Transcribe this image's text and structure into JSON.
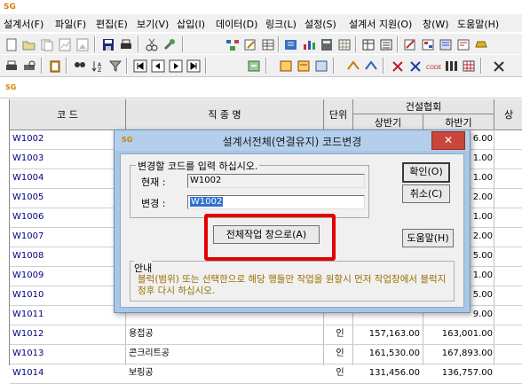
{
  "app_logo": "SG",
  "menu": [
    "설계서(F)",
    "파일(F)",
    "편집(E)",
    "보기(V)",
    "삽입(I)",
    "데이터(D)",
    "링크(L)",
    "설정(S)",
    "설계서 지원(O)",
    "창(W)",
    "도움말(H)"
  ],
  "grid": {
    "headers": {
      "code": "코 드",
      "name": "직 종 명",
      "unit": "단위",
      "group": "건설협회",
      "first_half": "상반기",
      "second_half": "하반기",
      "extra": "상"
    },
    "rows": [
      {
        "code": "W1002",
        "name": "",
        "unit": "",
        "first_half": "",
        "second_half": "6.00"
      },
      {
        "code": "W1003",
        "name": "",
        "unit": "",
        "first_half": "",
        "second_half": "1.00"
      },
      {
        "code": "W1004",
        "name": "",
        "unit": "",
        "first_half": "",
        "second_half": "1.00"
      },
      {
        "code": "W1005",
        "name": "",
        "unit": "",
        "first_half": "",
        "second_half": "2.00"
      },
      {
        "code": "W1006",
        "name": "",
        "unit": "",
        "first_half": "",
        "second_half": "1.00"
      },
      {
        "code": "W1007",
        "name": "",
        "unit": "",
        "first_half": "",
        "second_half": "2.00"
      },
      {
        "code": "W1008",
        "name": "",
        "unit": "",
        "first_half": "",
        "second_half": "5.00"
      },
      {
        "code": "W1009",
        "name": "",
        "unit": "",
        "first_half": "",
        "second_half": "1.00"
      },
      {
        "code": "W1010",
        "name": "",
        "unit": "",
        "first_half": "",
        "second_half": "5.00"
      },
      {
        "code": "W1011",
        "name": "",
        "unit": "",
        "first_half": "",
        "second_half": "9.00"
      },
      {
        "code": "W1012",
        "name": "용접공",
        "unit": "인",
        "first_half": "157,163.00",
        "second_half": "163,001.00"
      },
      {
        "code": "W1013",
        "name": "콘크리트공",
        "unit": "인",
        "first_half": "161,530.00",
        "second_half": "167,893.00"
      },
      {
        "code": "W1014",
        "name": "보링공",
        "unit": "인",
        "first_half": "131,456.00",
        "second_half": "136,757.00"
      }
    ]
  },
  "dialog": {
    "logo": "SG",
    "title": "설계서전체(연결유지) 코드변경",
    "close_glyph": "✕",
    "group_caption": "변경할 코드를 입력 하십시오.",
    "current_label": "현재 :",
    "current_value": "W1002",
    "change_label": "변경 :",
    "change_value": "W1002",
    "ok_button": "확인(O)",
    "cancel_button": "취소(C)",
    "all_work_button": "전체작업 창으로(A)",
    "help_button": "도움말(H)",
    "notice_caption": "안내",
    "notice_text": "블럭(범위) 또는 선택한으로 해당 행들만 작업을 원할시 먼저 작업창에서 블럭지정후 다시 하십시오.",
    "highlight_color": "#e00000"
  }
}
